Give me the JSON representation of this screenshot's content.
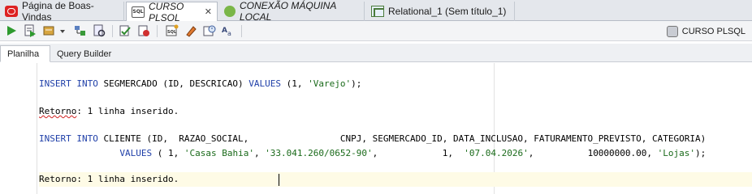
{
  "tabs": [
    {
      "label": "Página de Boas-Vindas",
      "icon": "oracle-icon",
      "italic": false
    },
    {
      "label": "CURSO PLSQL",
      "icon": "sql-worksheet-icon",
      "italic": true
    },
    {
      "label": "CONEXÃO MÁQUINA LOCAL",
      "icon": "connection-icon",
      "italic": true
    },
    {
      "label": "Relational_1 (Sem título_1)",
      "icon": "relational-model-icon",
      "italic": false
    }
  ],
  "toolbar": {
    "buttons": [
      "run-statement-icon",
      "run-script-icon",
      "commit-icon",
      "dropdown-arrow-icon",
      "explain-plan-icon",
      "autotrace-icon",
      "commit-transaction-icon",
      "rollback-icon",
      "sql-tuning-icon",
      "clear-icon",
      "history-icon",
      "format-icon"
    ],
    "connection_label": "CURSO PLSQL"
  },
  "subtabs": {
    "worksheet": "Planilha",
    "query_builder": "Query Builder"
  },
  "editor": {
    "line1": {
      "insert": "INSERT INTO",
      "rest1": " SEGMERCADO (ID, DESCRICAO) ",
      "values": "VALUES",
      "rest2": " (1, ",
      "str": "'Varejo'",
      "end": ");"
    },
    "line2": {
      "prefix": "Retorno",
      "rest": ": 1 linha inserido."
    },
    "line3": {
      "insert": "INSERT INTO",
      "rest": " CLIENTE (ID,  RAZAO_SOCIAL,                 CNPJ, SEGMERCADO_ID, DATA_INCLUSAO, FATURAMENTO_PREVISTO, CATEGORIA)"
    },
    "line4": {
      "indent": "               ",
      "values": "VALUES",
      "p1": " ( 1, ",
      "s1": "'Casas Bahia'",
      "p2": ", ",
      "s2": "'33.041.260/0652-90'",
      "p3": ",            1,  ",
      "s3": "'07.04.2026'",
      "p4": ",          10000000.00, ",
      "s4": "'Lojas'",
      "end": ");"
    },
    "line5": {
      "text": "Retorno: 1 linha inserido."
    }
  }
}
